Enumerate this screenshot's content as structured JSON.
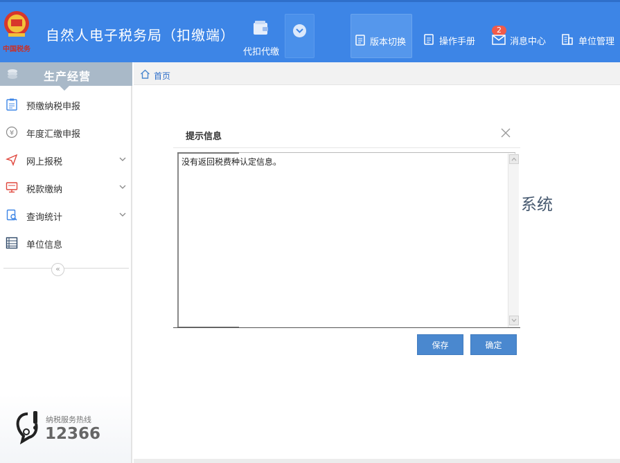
{
  "header": {
    "title": "自然人电子税务局（扣缴端）",
    "emblem_text": "中国税务",
    "nav": {
      "withhold_label": "代扣代缴",
      "version_label": "版本切换",
      "manual_label": "操作手册",
      "message_label": "消息中心",
      "message_badge": "2",
      "unit_label": "单位管理"
    }
  },
  "sidebar": {
    "title": "生产经营",
    "items": [
      {
        "label": "预缴纳税申报",
        "icon": "clipboard-icon"
      },
      {
        "label": "年度汇缴申报",
        "icon": "yen-icon"
      },
      {
        "label": "网上报税",
        "icon": "paper-plane-icon"
      },
      {
        "label": "税款缴纳",
        "icon": "monitor-icon"
      },
      {
        "label": "查询统计",
        "icon": "search-document-icon"
      },
      {
        "label": "单位信息",
        "icon": "list-icon"
      }
    ],
    "collapse_symbol": "«",
    "hotline_label": "纳税服务热线",
    "hotline_number": "12366"
  },
  "breadcrumb": {
    "home_label": "首页"
  },
  "main": {
    "background_text": "系统"
  },
  "dialog": {
    "title": "提示信息",
    "message": "没有返回税费种认定信息。",
    "save_label": "保存",
    "ok_label": "确定"
  },
  "colors": {
    "header_bg": "#3d85e6",
    "button_bg": "#4a88cf",
    "sidebar_head_bg": "#a9b9c8",
    "badge_bg": "#f05a4a"
  }
}
